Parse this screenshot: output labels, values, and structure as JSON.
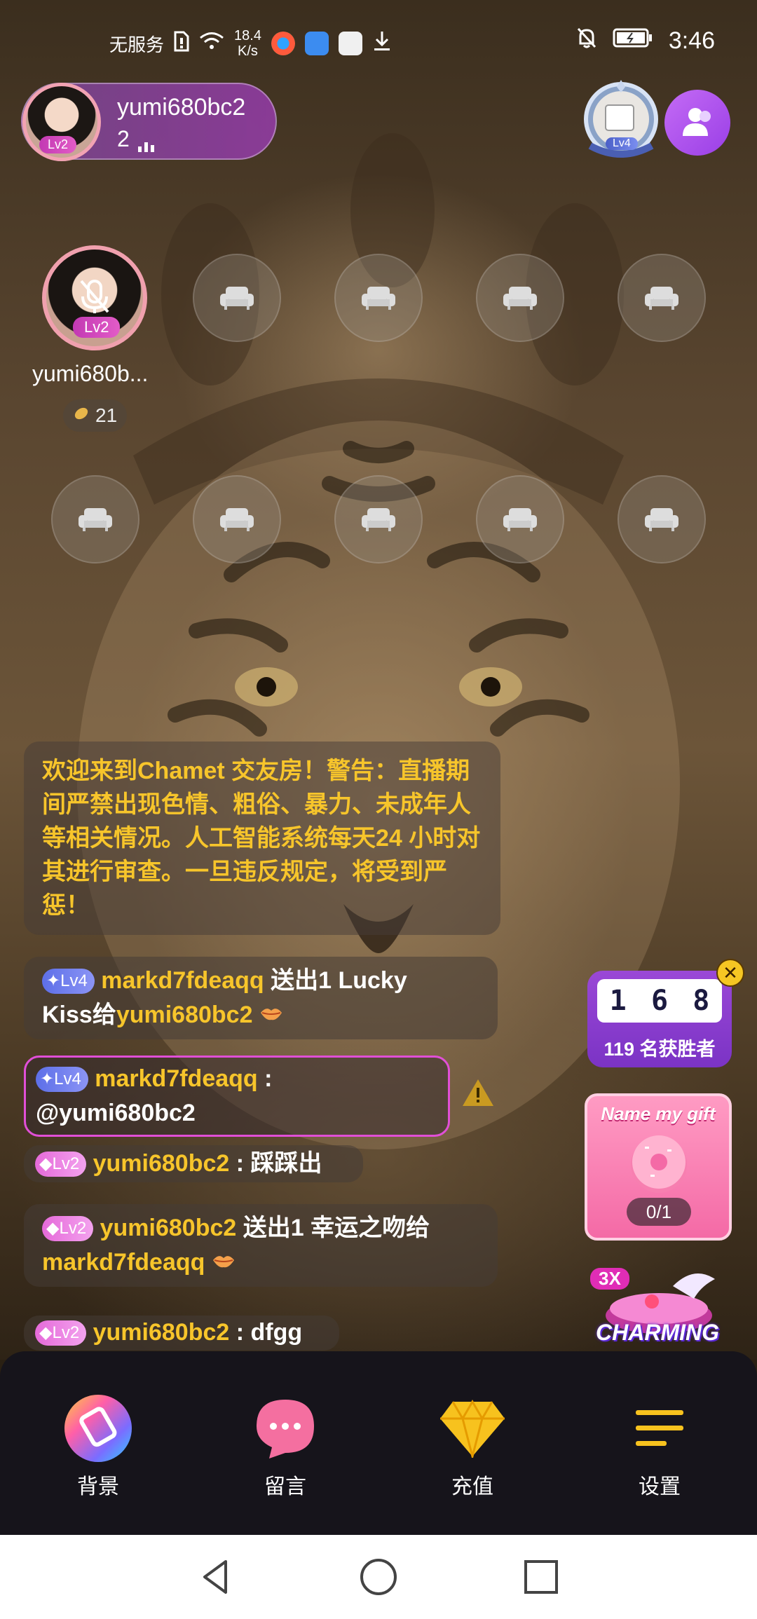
{
  "status_bar": {
    "carrier": "无服务",
    "net_speed_value": "18.4",
    "net_speed_unit": "K/s",
    "time": "3:46"
  },
  "host": {
    "name": "yumi680bc2",
    "level": "Lv2",
    "online_count": "2"
  },
  "top_badge": {
    "level": "Lv4"
  },
  "seats": {
    "host_seat_name": "yumi680b...",
    "host_seat_level": "Lv2",
    "host_seat_score": "21"
  },
  "chat": {
    "system_notice": "欢迎来到Chamet 交友房！警告：直播期间严禁出现色情、粗俗、暴力、未成年人等相关情况。人工智能系统每天24 小时对其进行审查。一旦违反规定，将受到严惩！",
    "messages": [
      {
        "level": "Lv4",
        "user": "markd7fdeaqq",
        "text_a": " 送出1 Lucky",
        "text_b": "Kiss给",
        "target": "yumi680bc2"
      },
      {
        "level": "Lv4",
        "user": "markd7fdeaqq",
        "text_a": " :",
        "text_b": "@yumi680bc2"
      },
      {
        "level": "Lv2",
        "user": "yumi680bc2",
        "text_a": " : 踩踩出"
      },
      {
        "level": "Lv2",
        "user": "yumi680bc2",
        "text_a": " 送出1 幸运之吻给",
        "target": "markd7fdeaqq"
      },
      {
        "level": "Lv2",
        "user": "yumi680bc2",
        "text_a": " : dfgg"
      }
    ]
  },
  "lucky_widget": {
    "digits": [
      "1",
      "6",
      "8"
    ],
    "winners": "119 名获胜者"
  },
  "gift_widget": {
    "title": "Name my gift",
    "progress": "0/1"
  },
  "charming_widget": {
    "multiplier": "3X",
    "label": "CHARMING"
  },
  "toolbar": {
    "items": [
      {
        "label": "背景",
        "icon": "background-icon"
      },
      {
        "label": "留言",
        "icon": "message-icon"
      },
      {
        "label": "充值",
        "icon": "diamond-icon"
      },
      {
        "label": "设置",
        "icon": "settings-icon"
      }
    ]
  },
  "colors": {
    "chat_username": "#f7c52b",
    "accent_purple": "#9a48d6",
    "level4": "#5d6fe8",
    "level2": "#e56ad9"
  }
}
